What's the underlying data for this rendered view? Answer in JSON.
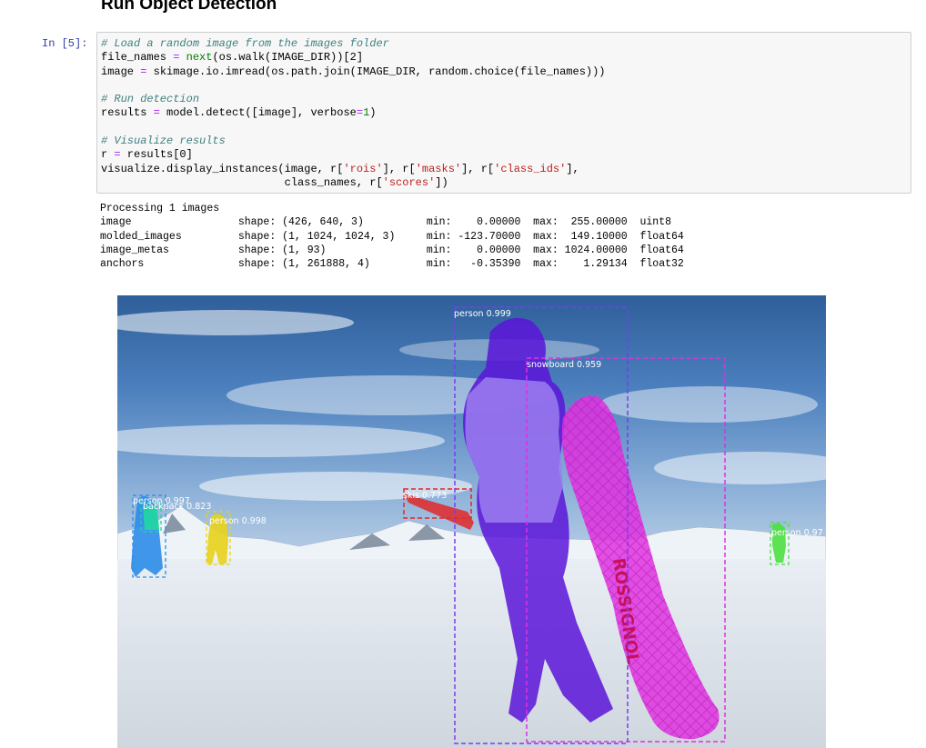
{
  "notebook": {
    "heading": "Run Object Detection",
    "cell_prompt": "In  [5]:",
    "code": {
      "c1": "# Load a random image from the images folder",
      "l1a": "file_names ",
      "l1b": "=",
      "l1c": " ",
      "l1d": "next",
      "l1e": "(os.walk(IMAGE_DIR))[2]",
      "l2a": "image ",
      "l2b": "=",
      "l2c": " skimage.io.imread(os.path.join(IMAGE_DIR, random.choice(file_names)))",
      "c2": "# Run detection",
      "l3a": "results ",
      "l3b": "=",
      "l3c": " model.detect([image], verbose",
      "l3d": "=",
      "l3e": "1",
      "l3f": ")",
      "c3": "# Visualize results",
      "l4a": "r ",
      "l4b": "=",
      "l4c": " results[0]",
      "l5a": "visualize.display_instances(image, r[",
      "l5b": "'rois'",
      "l5c": "], r[",
      "l5d": "'masks'",
      "l5e": "], r[",
      "l5f": "'class_ids'",
      "l5g": "],",
      "l6a": "                            class_names, r[",
      "l6b": "'scores'",
      "l6c": "])"
    },
    "output_lines": [
      "Processing 1 images",
      "image                 shape: (426, 640, 3)          min:    0.00000  max:  255.00000  uint8",
      "molded_images         shape: (1, 1024, 1024, 3)     min: -123.70000  max:  149.10000  float64",
      "image_metas           shape: (1, 93)                min:    0.00000  max: 1024.00000  float64",
      "anchors               shape: (1, 261888, 4)         min:   -0.35390  max:    1.29134  float32"
    ],
    "detections": [
      {
        "label": "person 0.999",
        "color": "#7a3cf0"
      },
      {
        "label": "snowboard 0.959",
        "color": "#e030e0"
      },
      {
        "label": "skis 0.773",
        "color": "#e02828"
      },
      {
        "label": "person 0.998",
        "color": "#e8d21a"
      },
      {
        "label": "person 0.997",
        "color": "#2b8ce8"
      },
      {
        "label": "backpack 0.823",
        "color": "#20d8a0"
      },
      {
        "label": "person 0.97",
        "color": "#4ce040"
      }
    ],
    "board_text": "ROSSIGNOL"
  }
}
